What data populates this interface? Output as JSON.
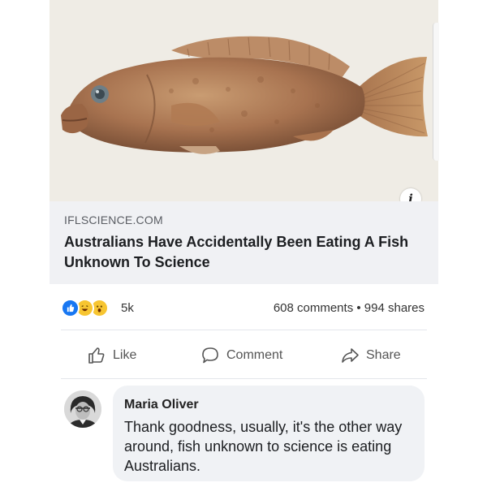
{
  "post": {
    "link": {
      "domain": "IFLSCIENCE.COM",
      "headline": "Australians Have Accidentally Been Eating A Fish Unknown To Science",
      "info_icon": "i"
    },
    "reactions": {
      "icons": [
        "like-icon",
        "haha-icon",
        "wow-icon"
      ],
      "count": "5k",
      "comments_shares": "608 comments • 994 shares"
    },
    "actions": {
      "like": "Like",
      "comment": "Comment",
      "share": "Share"
    },
    "comment": {
      "author": "Maria Oliver",
      "text": "Thank goodness, usually, it's the other way around, fish unknown to science is eating Australians."
    }
  },
  "colors": {
    "accent": "#1877f2",
    "reaction_yellow": "#f7c531",
    "link_background": "#f0f1f4",
    "bubble_background": "#f0f2f5"
  }
}
